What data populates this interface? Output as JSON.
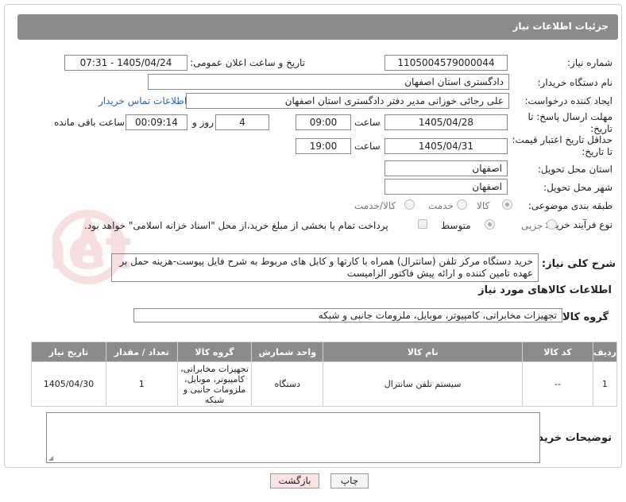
{
  "header": {
    "title": "جزئیات اطلاعات نیاز"
  },
  "fields": {
    "need_number_label": "شماره نیاز:",
    "need_number": "1105004579000044",
    "announce_label": "تاریخ و ساعت اعلان عمومی:",
    "announce_value": "1405/04/24 - 07:31",
    "buyer_org_label": "نام دستگاه خریدار:",
    "buyer_org": "دادگستری استان اصفهان",
    "creator_label": "ایجاد کننده درخواست:",
    "creator": "علی رجائی خوزانی مدیر دفتر دادگستری استان اصفهان",
    "buyer_contact_link": "اطلاعات تماس خریدار",
    "deadline_label_1": "مهلت ارسال پاسخ: تا",
    "deadline_label_2": "تاریخ:",
    "deadline_date": "1405/04/28",
    "time_label": "ساعت",
    "deadline_time": "09:00",
    "days_value": "4",
    "days_label": "روز و",
    "remaining_time": "00:09:14",
    "remaining_label": "ساعت باقی مانده",
    "price_label_1": "حداقل تاریخ اعتبار قیمت:",
    "price_label_2": "تا تاریخ:",
    "price_date": "1405/04/31",
    "price_time": "19:00",
    "province_label": "استان محل تحویل:",
    "province": "اصفهان",
    "city_label": "شهر محل تحویل:",
    "city": "اصفهان",
    "category_label": "طبقه بندی موضوعی:",
    "category_options": [
      "کالا",
      "خدمت",
      "کالا/خدمت"
    ],
    "process_label": "نوع فرآیند خرید :",
    "process_options": [
      "جزیی",
      "متوسط"
    ],
    "payment_note": "پرداخت تمام یا بخشی از مبلغ خرید،از محل \"اسناد خزانه اسلامی\" خواهد بود.",
    "general_desc_label": "شرح کلی نیاز:",
    "general_desc": "خرید دستگاه مرکز تلفن (سانترال) همراه با کارتها و کابل های مربوط به شرح فایل پیوست-هزینه حمل بر عهده تامین کننده و ارائه پیش فاکتور الزامیست",
    "goods_info_title": "اطلاعات کالاهای مورد نیاز",
    "goods_group_label": "گروه کالا:",
    "goods_group": "تجهیزات مخابراتی، کامپیوتر، موبایل، ملزومات جانبی و شبکه",
    "buyer_notes_label": "توضیحات خریدار:"
  },
  "table": {
    "headers": [
      "ردیف",
      "کد کالا",
      "نام کالا",
      "واحد شمارش",
      "گروه کالا",
      "تعداد / مقدار",
      "تاریخ نیاز"
    ],
    "rows": [
      {
        "row": "1",
        "code": "--",
        "name": "سیستم تلفن سانترال",
        "unit": "دستگاه",
        "group_lines": [
          "تجهیزات مخابراتی،",
          "کامپیوتر، موبایل،",
          "ملزومات جانبی و",
          "شبکه"
        ],
        "qty": "1",
        "date": "1405/04/30"
      }
    ]
  },
  "buttons": {
    "print": "چاپ",
    "back": "بازگشت"
  },
  "watermark": {
    "text": "AriaTender.net"
  },
  "colors": {
    "header_bg": "#8b8b8b",
    "link": "#2a63b8",
    "back_button_bg": "#fbe3e3"
  }
}
